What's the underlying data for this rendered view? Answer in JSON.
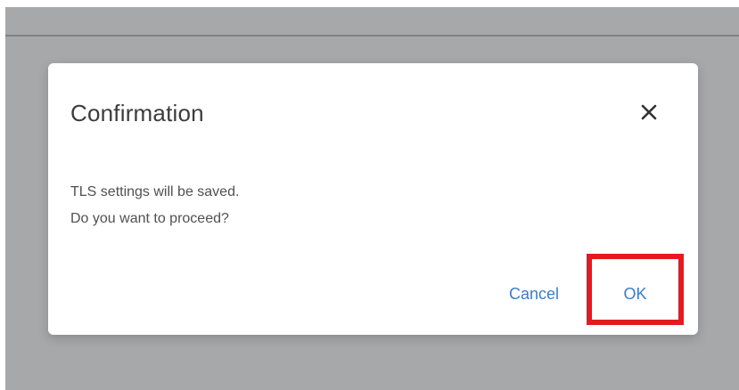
{
  "dialog": {
    "title": "Confirmation",
    "message_line1": "TLS settings will be saved.",
    "message_line2": "Do you want to proceed?",
    "cancel_label": "Cancel",
    "ok_label": "OK"
  },
  "colors": {
    "overlay": "#a7a8aa",
    "primary_text": "#3c3c3c",
    "secondary_text": "#505050",
    "button_text": "#3a7dc9",
    "highlight": "#e31a22"
  },
  "icons": {
    "close": "close-icon"
  }
}
